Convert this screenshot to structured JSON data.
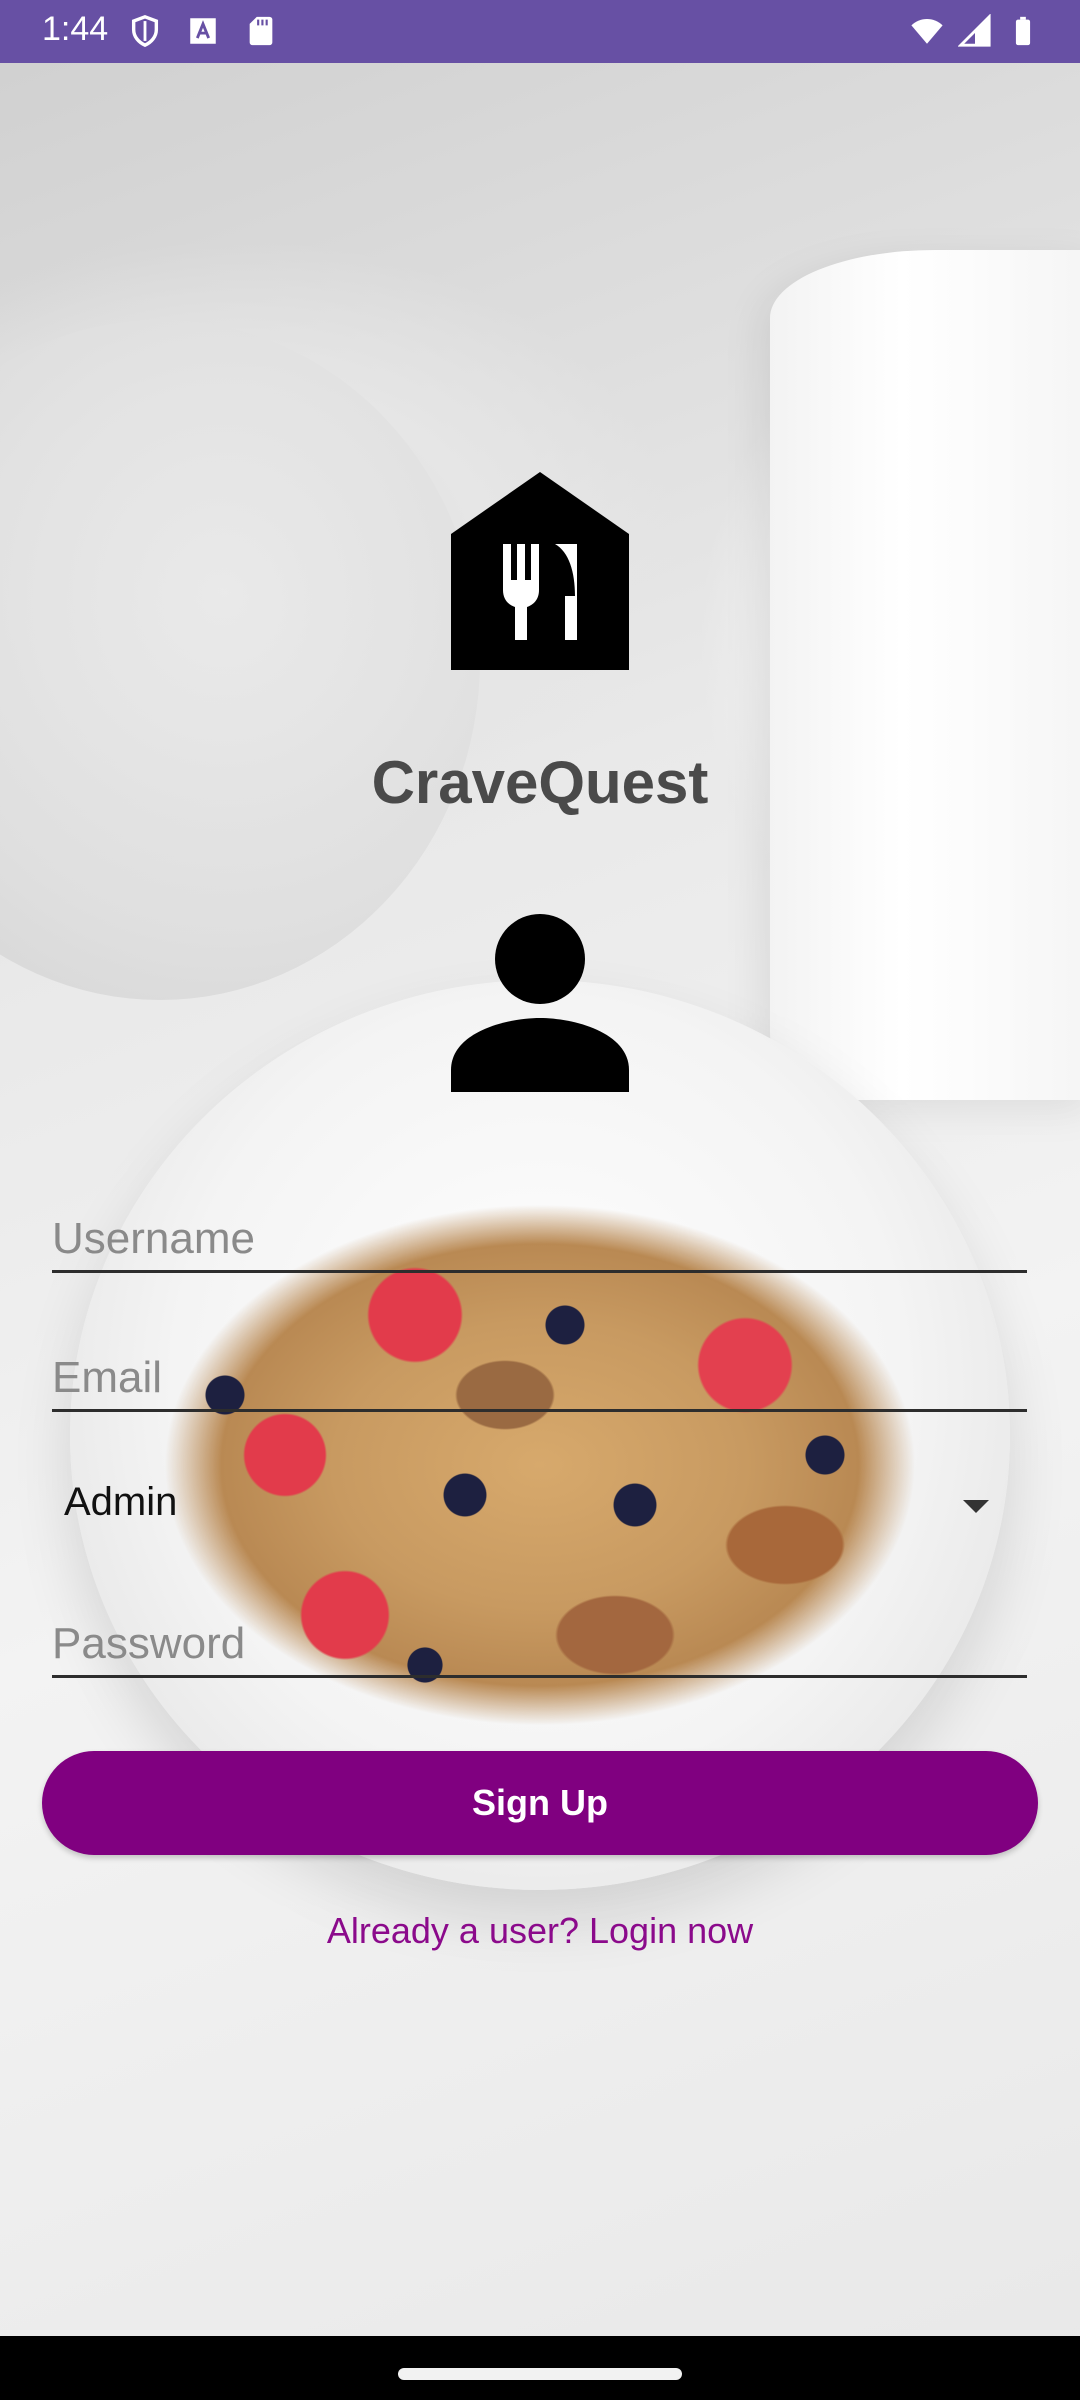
{
  "status_bar": {
    "time": "1:44",
    "left_icons": [
      "shield-icon",
      "a-icon",
      "sd-card-icon"
    ],
    "right_icons": [
      "wifi-icon",
      "signal-icon",
      "battery-icon"
    ],
    "color": "#6750a4"
  },
  "app": {
    "name": "CraveQuest",
    "logo_icon": "restaurant-house-icon",
    "avatar_icon": "person-icon"
  },
  "form": {
    "username_placeholder": "Username",
    "email_placeholder": "Email",
    "role_selected": "Admin",
    "password_placeholder": "Password",
    "signup_label": "Sign Up",
    "login_link": "Already a user? Login now",
    "accent_color": "#800080"
  }
}
